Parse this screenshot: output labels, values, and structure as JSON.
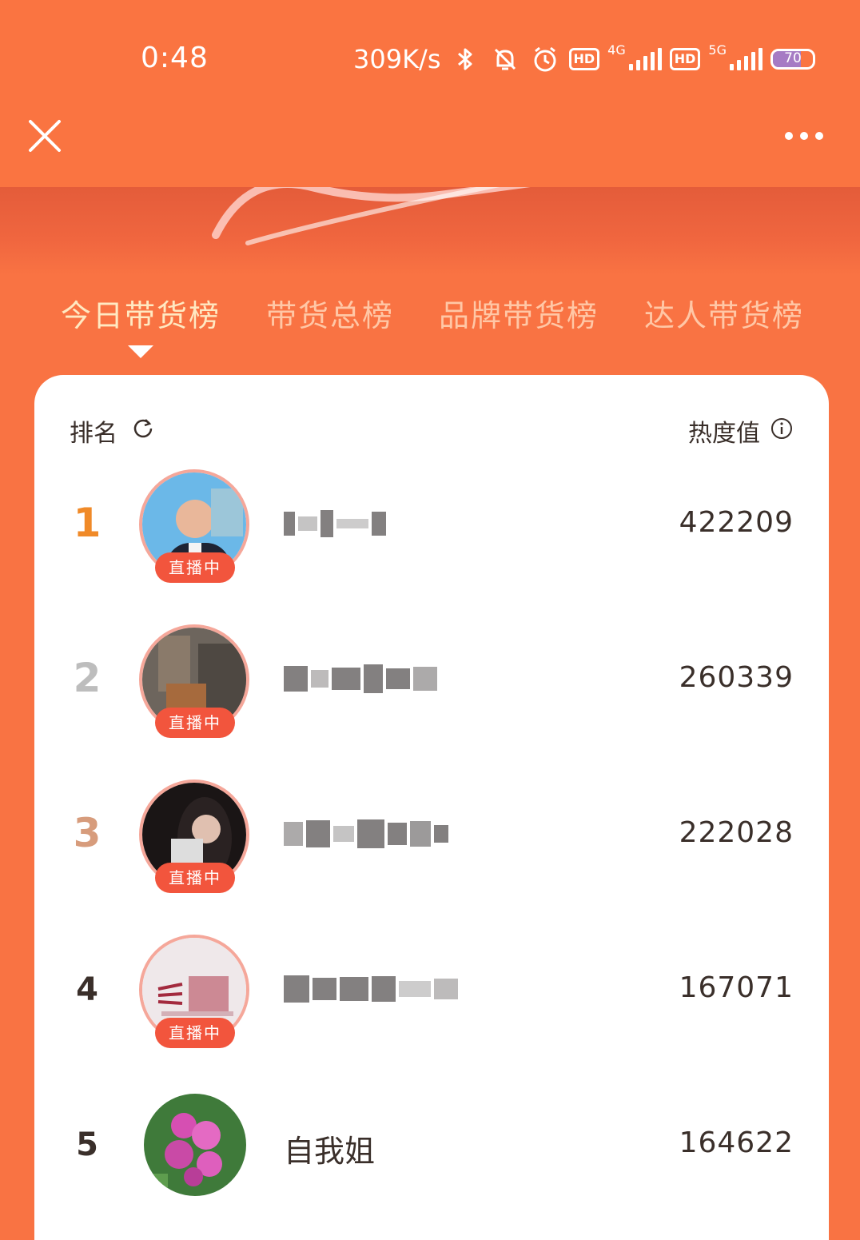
{
  "status_bar": {
    "time": "0:48",
    "net_speed": "309K/s",
    "hd_1": "HD",
    "net_1": "4G",
    "hd_2": "HD",
    "net_2": "5G",
    "battery": "70",
    "battery_level": 0.7
  },
  "nav": {
    "close_icon": "close-icon",
    "more_icon": "more-icon"
  },
  "tabs": [
    {
      "label": "今日带货榜",
      "active": true
    },
    {
      "label": "带货总榜",
      "active": false
    },
    {
      "label": "品牌带货榜",
      "active": false
    },
    {
      "label": "达人带货榜",
      "active": false
    }
  ],
  "list_header": {
    "rank_label": "排名",
    "heat_label": "热度值"
  },
  "rows": [
    {
      "rank": "1",
      "name": "",
      "heat": "422209",
      "badge": "直播中"
    },
    {
      "rank": "2",
      "name": "",
      "heat": "260339",
      "badge": "直播中"
    },
    {
      "rank": "3",
      "name": "",
      "heat": "222028",
      "badge": "直播中"
    },
    {
      "rank": "4",
      "name": "",
      "heat": "167071",
      "badge": "直播中"
    },
    {
      "rank": "5",
      "name": "自我姐",
      "heat": "164622",
      "badge": ""
    }
  ],
  "colors": {
    "background": "#f97343",
    "rank_1": "#f08a28",
    "rank_2": "#bdbdbd",
    "rank_3": "#d79c7c",
    "live_badge": "#f2553d",
    "active_tab": "#ffe9c2",
    "inactive_tab": "#ffc7a6"
  }
}
